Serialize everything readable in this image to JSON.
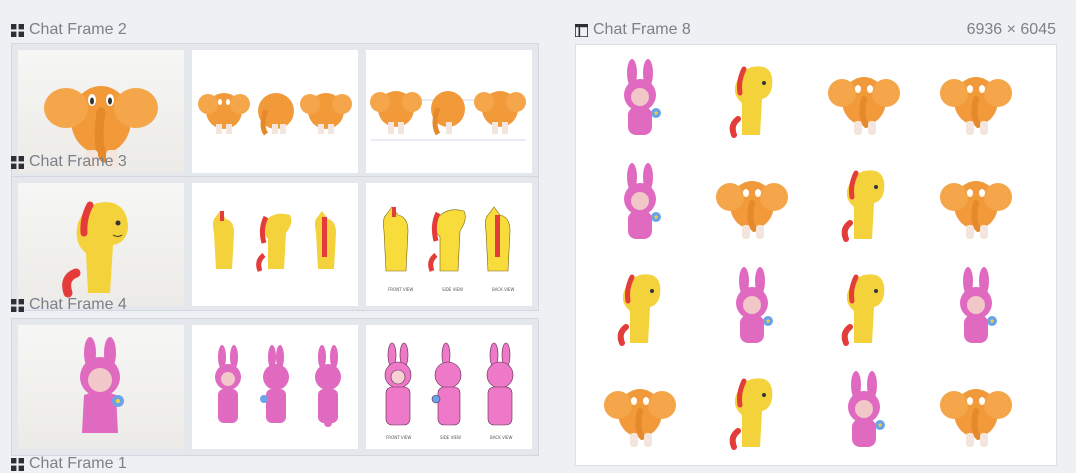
{
  "frames": {
    "frame2": {
      "label": "Chat Frame 2",
      "captions": [
        "",
        "",
        ""
      ]
    },
    "frame3": {
      "label": "Chat Frame 3",
      "captions": [
        "FRONT VIEW",
        "SIDE VIEW",
        "BACK VIEW"
      ]
    },
    "frame4": {
      "label": "Chat Frame 4",
      "captions": [
        "FRONT VIEW",
        "SIDE VIEW",
        "BACK VIEW"
      ]
    },
    "frame5": {
      "label": "Chat Frame 1"
    },
    "frame8": {
      "label": "Chat Frame 8",
      "dimensions": "6936 × 6045"
    }
  },
  "icons": {
    "grid": "grid-frame-icon",
    "layout": "layout-frame-icon"
  },
  "colors": {
    "elephant": "#f29a3a",
    "horse": "#f4d23b",
    "bunny": "#e06ac0",
    "label": "#7c8088"
  },
  "stickers": [
    [
      "bunny",
      "horse",
      "elephant",
      "elephant"
    ],
    [
      "bunny",
      "elephant",
      "horse",
      "elephant"
    ],
    [
      "horse",
      "bunny",
      "horse",
      "bunny"
    ],
    [
      "elephant",
      "horse",
      "bunny",
      "elephant"
    ]
  ]
}
